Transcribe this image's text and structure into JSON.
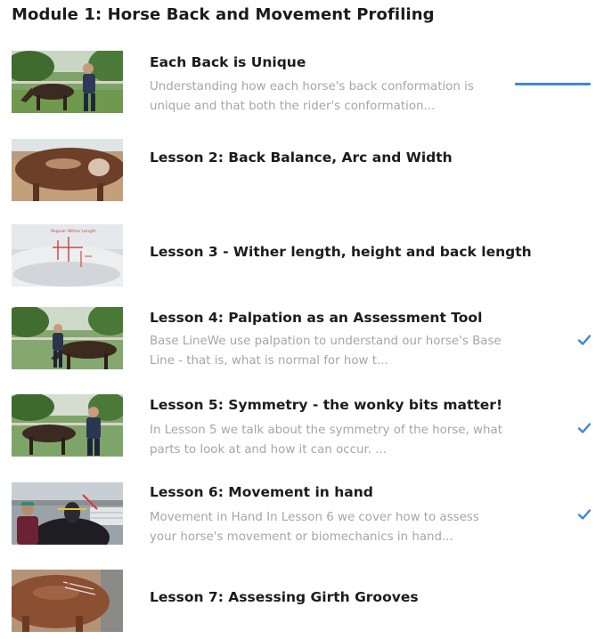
{
  "module": {
    "title": "Module 1: Horse Back and Movement Profiling"
  },
  "lessons": [
    {
      "title": "Each Back is Unique",
      "description": "Understanding how each horse's back conformation is unique and that both the rider's conformation...",
      "completed": false,
      "current": true
    },
    {
      "title": "Lesson 2: Back Balance, Arc and Width",
      "description": "",
      "completed": false,
      "current": false
    },
    {
      "title": "Lesson 3 - Wither length, height and back length",
      "description": "",
      "completed": false,
      "current": false
    },
    {
      "title": "Lesson 4: Palpation as an Assessment Tool",
      "description": "Base LineWe use palpation to understand our horse's Base Line - that is, what is normal for how t...",
      "completed": true,
      "current": false
    },
    {
      "title": "Lesson 5: Symmetry - the wonky bits matter!",
      "description": "In Lesson 5 we talk about the symmetry of the horse, what parts to look at and how it can occur. ...",
      "completed": true,
      "current": false
    },
    {
      "title": "Lesson 6: Movement in hand",
      "description": "Movement in Hand In Lesson 6 we cover how to assess your horse's movement or biomechanics in hand...",
      "completed": true,
      "current": false
    },
    {
      "title": "Lesson 7: Assessing Girth Grooves",
      "description": "",
      "completed": false,
      "current": false
    }
  ],
  "thumbnail_text": {
    "lesson_3": "Regular Wither Length"
  },
  "colors": {
    "accent": "#3d86e0",
    "title_text": "#1c1c1c",
    "description_text": "#a6a6a6"
  },
  "icons": {
    "completed": "checkmark-icon",
    "current": "progress-indicator"
  }
}
